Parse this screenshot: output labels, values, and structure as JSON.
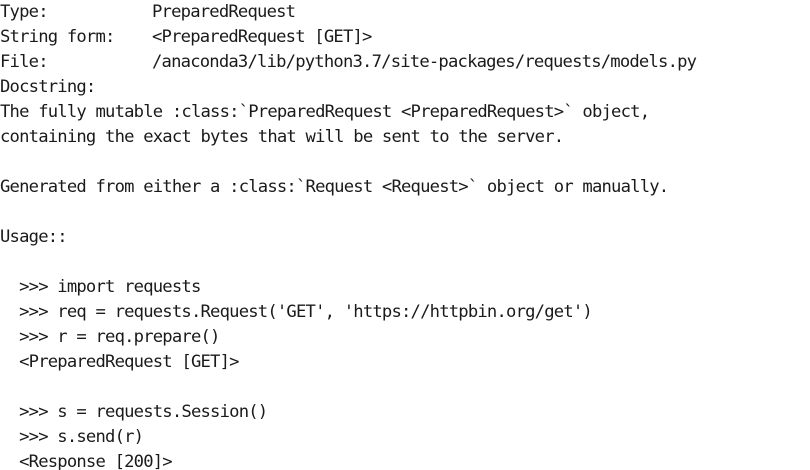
{
  "help": {
    "type_label": "Type:",
    "type_value": "PreparedRequest",
    "string_form_label": "String form:",
    "string_form_value": "<PreparedRequest [GET]>",
    "file_label": "File:",
    "file_value": "/anaconda3/lib/python3.7/site-packages/requests/models.py",
    "docstring_label": "Docstring:",
    "docstring_lines": [
      "The fully mutable :class:`PreparedRequest <PreparedRequest>` object,",
      "containing the exact bytes that will be sent to the server.",
      "",
      "Generated from either a :class:`Request <Request>` object or manually.",
      "",
      "Usage::",
      "",
      "  >>> import requests",
      "  >>> req = requests.Request('GET', 'https://httpbin.org/get')",
      "  >>> r = req.prepare()",
      "  <PreparedRequest [GET]>",
      "",
      "  >>> s = requests.Session()",
      "  >>> s.send(r)",
      "  <Response [200]>"
    ]
  }
}
